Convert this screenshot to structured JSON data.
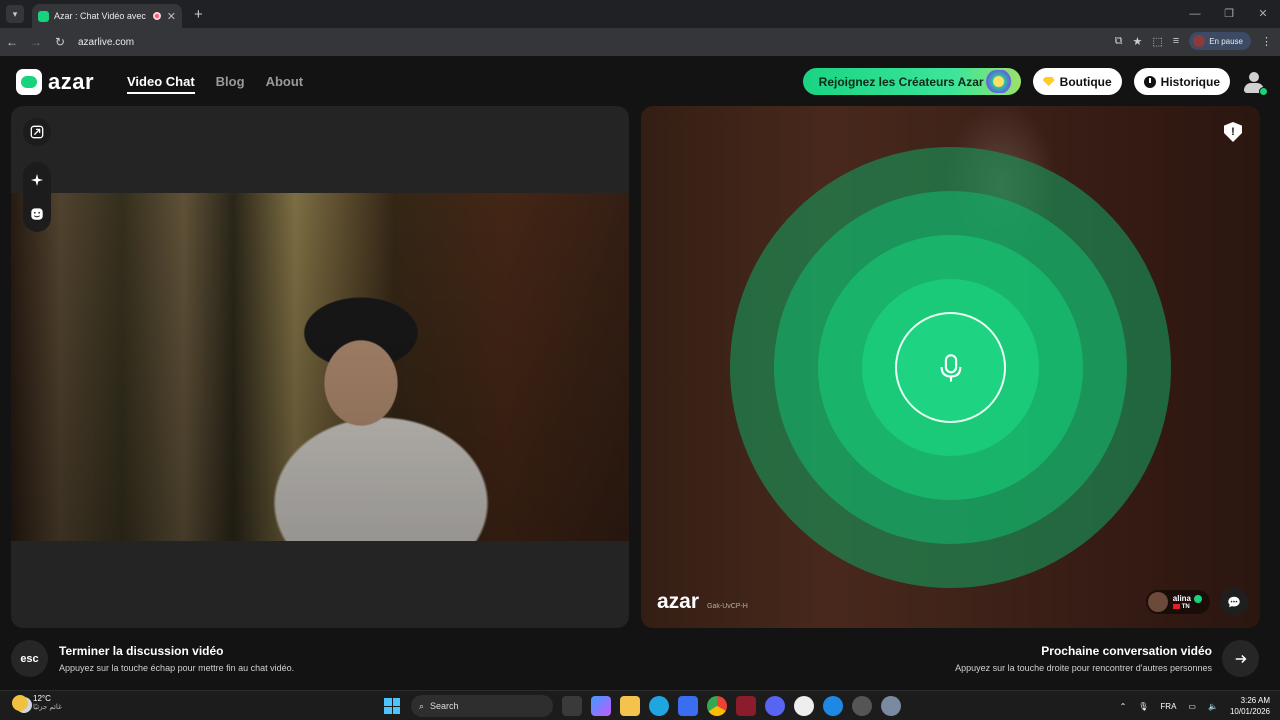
{
  "browser": {
    "tab_title": "Azar : Chat Vidéo avec de n",
    "url": "azarlive.com",
    "profile_status": "En pause"
  },
  "header": {
    "logo_text": "azar",
    "nav": [
      "Video Chat",
      "Blog",
      "About"
    ],
    "creators_button": "Rejoignez les Créateurs Azar",
    "shop_button": "Boutique",
    "history_button": "Historique"
  },
  "remote": {
    "watermark": "azar",
    "session_id": "Gak-UvCP-H",
    "peer_name": "alina",
    "peer_country": "TN"
  },
  "bottom": {
    "esc_key": "esc",
    "end_title": "Terminer la discussion vidéo",
    "end_sub": "Appuyez sur la touche échap pour mettre fin au chat vidéo.",
    "next_title": "Prochaine conversation vidéo",
    "next_sub": "Appuyez sur la touche droite pour rencontrer d'autres personnes"
  },
  "taskbar": {
    "temp": "12°C",
    "weather_text": "غائم جزئيًا",
    "search_label": "Search",
    "lang": "FRA",
    "time": "3:26 AM",
    "date": "10/01/2026"
  },
  "colors": {
    "accent": "#16d47b",
    "background": "#131313"
  }
}
